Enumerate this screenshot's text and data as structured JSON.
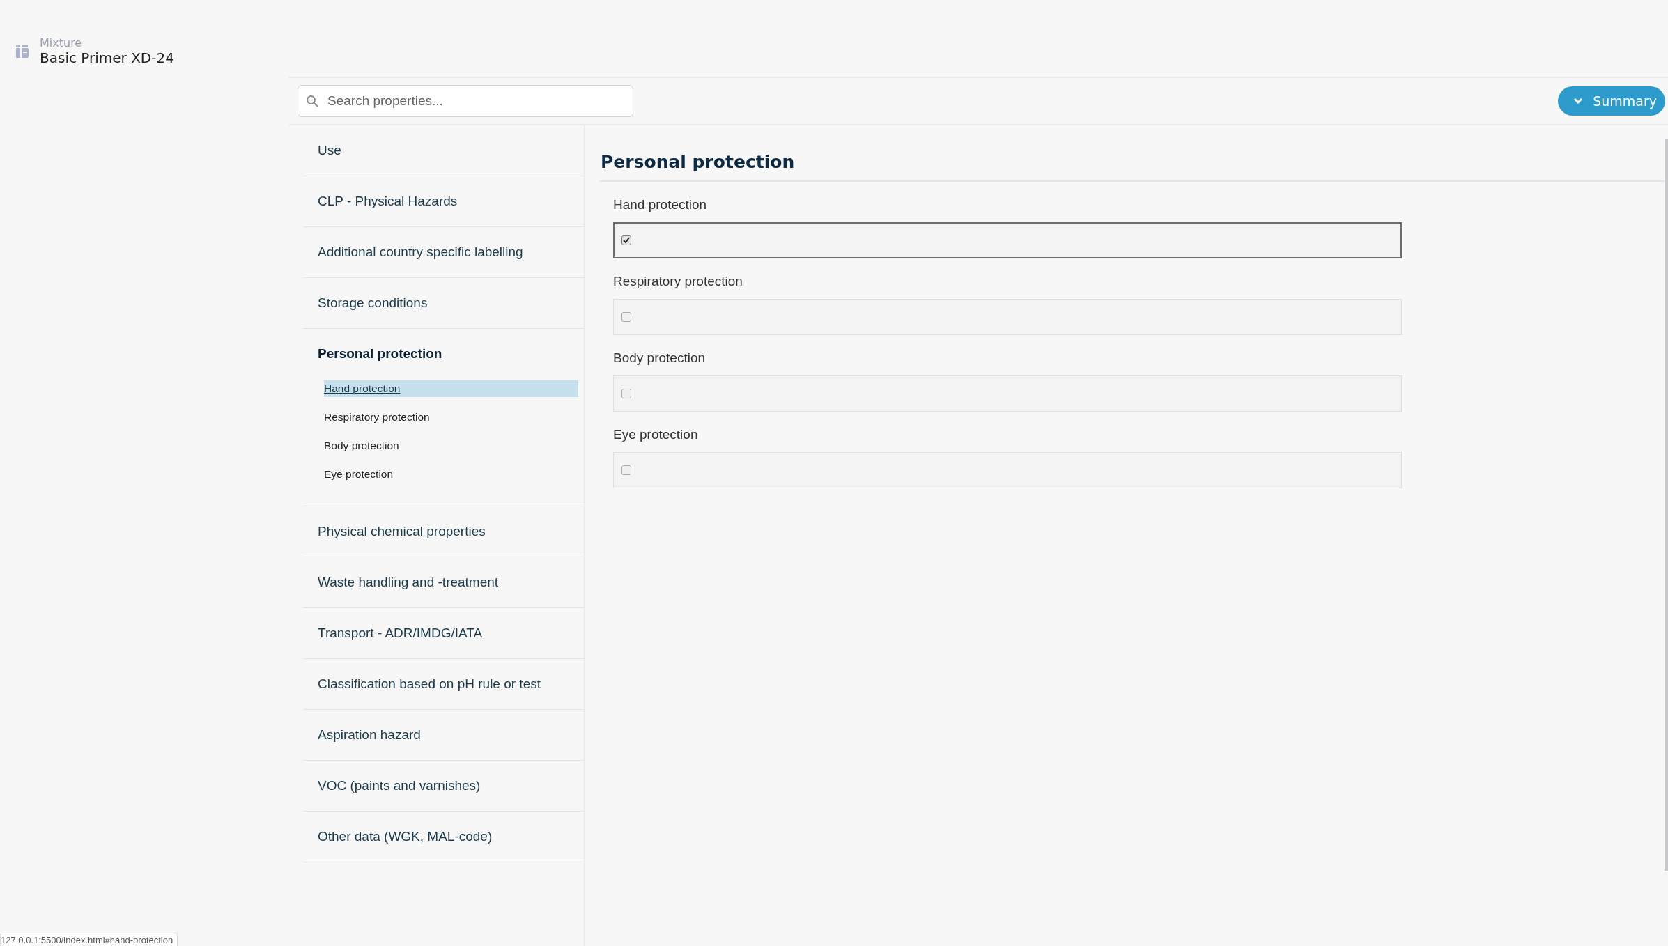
{
  "header": {
    "type_label": "Mixture",
    "title": "Basic Primer XD-24"
  },
  "search": {
    "placeholder": "Search properties..."
  },
  "summary_button": {
    "label": "Summary"
  },
  "nav": [
    {
      "label": "Use",
      "selected": false
    },
    {
      "label": "CLP - Physical Hazards",
      "selected": false
    },
    {
      "label": "Additional country specific labelling",
      "selected": false
    },
    {
      "label": "Storage conditions",
      "selected": false
    },
    {
      "label": "Personal protection",
      "selected": true,
      "expanded": true,
      "children": [
        {
          "label": "Hand protection",
          "selected": true
        },
        {
          "label": "Respiratory protection",
          "selected": false
        },
        {
          "label": "Body protection",
          "selected": false
        },
        {
          "label": "Eye protection",
          "selected": false
        }
      ]
    },
    {
      "label": "Physical chemical properties",
      "selected": false
    },
    {
      "label": "Waste handling and -treatment",
      "selected": false
    },
    {
      "label": "Transport - ADR/IMDG/IATA",
      "selected": false
    },
    {
      "label": "Classification based on pH rule or test",
      "selected": false
    },
    {
      "label": "Aspiration hazard",
      "selected": false
    },
    {
      "label": "VOC (paints and varnishes)",
      "selected": false
    },
    {
      "label": "Other data (WGK, MAL-code)",
      "selected": false
    }
  ],
  "section": {
    "title": "Personal protection",
    "fields": [
      {
        "label": "Hand protection",
        "checked": true,
        "focused": true
      },
      {
        "label": "Respiratory protection",
        "checked": false,
        "focused": false
      },
      {
        "label": "Body protection",
        "checked": false,
        "focused": false
      },
      {
        "label": "Eye protection",
        "checked": false,
        "focused": false
      }
    ]
  },
  "status_url": "127.0.0.1:5500/index.html#hand-protection"
}
